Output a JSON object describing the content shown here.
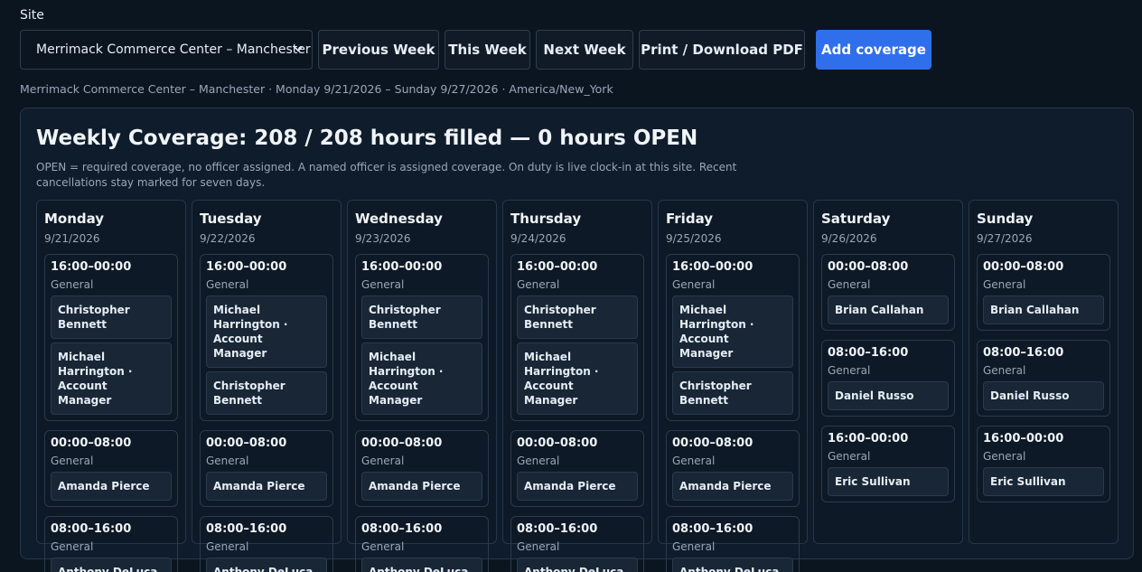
{
  "site": {
    "label": "Site",
    "selected": "Merrimack Commerce Center – Manchester"
  },
  "toolbar": {
    "previous_week": "Previous Week",
    "this_week": "This Week",
    "next_week": "Next Week",
    "print_pdf": "Print / Download PDF",
    "add_coverage": "Add coverage"
  },
  "subtitle": "Merrimack Commerce Center – Manchester · Monday 9/21/2026 – Sunday 9/27/2026 · America/New_York",
  "summary": {
    "title": "Weekly Coverage: 208 / 208 hours filled — 0 hours OPEN",
    "note": "OPEN = required coverage, no officer assigned. A named officer is assigned coverage. On duty is live clock-in at this site. Recent cancellations stay marked for seven days."
  },
  "colors": {
    "background": "#0b1520",
    "card": "#0f1c2b",
    "primary": "#2f6fec",
    "muted_text": "#9aa7b6"
  },
  "days": [
    {
      "name": "Monday",
      "date": "9/21/2026",
      "shifts": [
        {
          "time": "16:00–00:00",
          "type": "General",
          "officers": [
            "Christopher Bennett",
            "Michael Harrington · Account Manager"
          ]
        },
        {
          "time": "00:00–08:00",
          "type": "General",
          "officers": [
            "Amanda Pierce"
          ]
        },
        {
          "time": "08:00–16:00",
          "type": "General",
          "officers": [
            "Anthony DeLuca"
          ]
        }
      ]
    },
    {
      "name": "Tuesday",
      "date": "9/22/2026",
      "shifts": [
        {
          "time": "16:00–00:00",
          "type": "General",
          "officers": [
            "Michael Harrington · Account Manager",
            "Christopher Bennett"
          ]
        },
        {
          "time": "00:00–08:00",
          "type": "General",
          "officers": [
            "Amanda Pierce"
          ]
        },
        {
          "time": "08:00–16:00",
          "type": "General",
          "officers": [
            "Anthony DeLuca"
          ]
        }
      ]
    },
    {
      "name": "Wednesday",
      "date": "9/23/2026",
      "shifts": [
        {
          "time": "16:00–00:00",
          "type": "General",
          "officers": [
            "Christopher Bennett",
            "Michael Harrington · Account Manager"
          ]
        },
        {
          "time": "00:00–08:00",
          "type": "General",
          "officers": [
            "Amanda Pierce"
          ]
        },
        {
          "time": "08:00–16:00",
          "type": "General",
          "officers": [
            "Anthony DeLuca"
          ]
        }
      ]
    },
    {
      "name": "Thursday",
      "date": "9/24/2026",
      "shifts": [
        {
          "time": "16:00–00:00",
          "type": "General",
          "officers": [
            "Christopher Bennett",
            "Michael Harrington · Account Manager"
          ]
        },
        {
          "time": "00:00–08:00",
          "type": "General",
          "officers": [
            "Amanda Pierce"
          ]
        },
        {
          "time": "08:00–16:00",
          "type": "General",
          "officers": [
            "Anthony DeLuca"
          ]
        }
      ]
    },
    {
      "name": "Friday",
      "date": "9/25/2026",
      "shifts": [
        {
          "time": "16:00–00:00",
          "type": "General",
          "officers": [
            "Michael Harrington · Account Manager",
            "Christopher Bennett"
          ]
        },
        {
          "time": "00:00–08:00",
          "type": "General",
          "officers": [
            "Amanda Pierce"
          ]
        },
        {
          "time": "08:00–16:00",
          "type": "General",
          "officers": [
            "Anthony DeLuca"
          ]
        }
      ]
    },
    {
      "name": "Saturday",
      "date": "9/26/2026",
      "shifts": [
        {
          "time": "00:00–08:00",
          "type": "General",
          "officers": [
            "Brian Callahan"
          ]
        },
        {
          "time": "08:00–16:00",
          "type": "General",
          "officers": [
            "Daniel Russo"
          ]
        },
        {
          "time": "16:00–00:00",
          "type": "General",
          "officers": [
            "Eric Sullivan"
          ]
        }
      ]
    },
    {
      "name": "Sunday",
      "date": "9/27/2026",
      "shifts": [
        {
          "time": "00:00–08:00",
          "type": "General",
          "officers": [
            "Brian Callahan"
          ]
        },
        {
          "time": "08:00–16:00",
          "type": "General",
          "officers": [
            "Daniel Russo"
          ]
        },
        {
          "time": "16:00–00:00",
          "type": "General",
          "officers": [
            "Eric Sullivan"
          ]
        }
      ]
    }
  ]
}
